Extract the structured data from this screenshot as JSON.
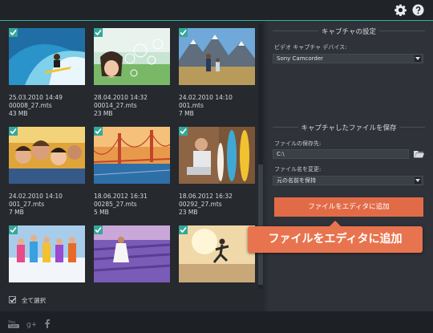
{
  "topbar": {
    "settings_icon": "gear-icon",
    "help_icon": "question-icon"
  },
  "colors": {
    "accent": "#33b3a6",
    "primary_button": "#e26b47",
    "callout": "#e8744f",
    "checkbox": "#35a89a"
  },
  "gallery": {
    "items": [
      {
        "date": "25.03.2010 14:49",
        "filename": "00008_27.mts",
        "size": "43 MB",
        "subject": "surfer"
      },
      {
        "date": "28.04.2010 14:32",
        "filename": "00014_27.mts",
        "size": "23 MB",
        "subject": "bubbles"
      },
      {
        "date": "24.02.2010 14:10",
        "filename": "001.mts",
        "size": "7 MB",
        "subject": "mountains"
      },
      {
        "date": "24.02.2010 14:10",
        "filename": "001_27.mts",
        "size": "7 MB",
        "subject": "friends-selfie"
      },
      {
        "date": "18.06.2012 16:31",
        "filename": "00285_27.mts",
        "size": "5 MB",
        "subject": "golden-gate-bridge"
      },
      {
        "date": "18.06.2012 16:32",
        "filename": "00292_27.mts",
        "size": "23 MB",
        "subject": "laptop-surfboards"
      },
      {
        "subject": "ski-group"
      },
      {
        "subject": "lavender-field"
      },
      {
        "subject": "runner-sunset"
      }
    ],
    "select_all_label": "全て選択",
    "select_all_checked": true
  },
  "capture_settings": {
    "title": "キャプチャの設定",
    "device_label": "ビデオ キャプチャ デバイス:",
    "device_value": "Sony Camcorder"
  },
  "save_settings": {
    "title": "キャプチャしたファイルを保存",
    "location_label": "ファイルの保存先:",
    "location_value": "C:\\",
    "rename_label": "ファイル名を変更:",
    "rename_value": "元の名前を保持"
  },
  "add_button_label": "ファイルをエディタに追加",
  "callout_text": "ファイルをエディタに追加",
  "social_icons": [
    "youtube-icon",
    "google-plus-icon",
    "facebook-icon"
  ]
}
